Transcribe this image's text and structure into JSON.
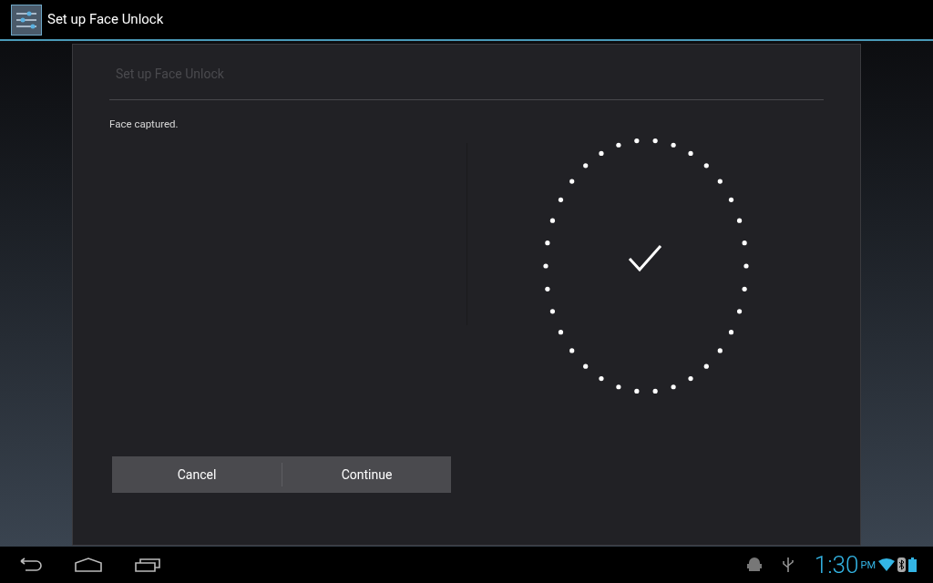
{
  "action_bar": {
    "title": "Set up Face Unlock"
  },
  "dialog": {
    "title": "Set up Face Unlock",
    "message": "Face captured.",
    "buttons": [
      {
        "label": "Cancel"
      },
      {
        "label": "Continue"
      }
    ]
  },
  "status_bar": {
    "time": "1:30",
    "ampm": "PM"
  }
}
